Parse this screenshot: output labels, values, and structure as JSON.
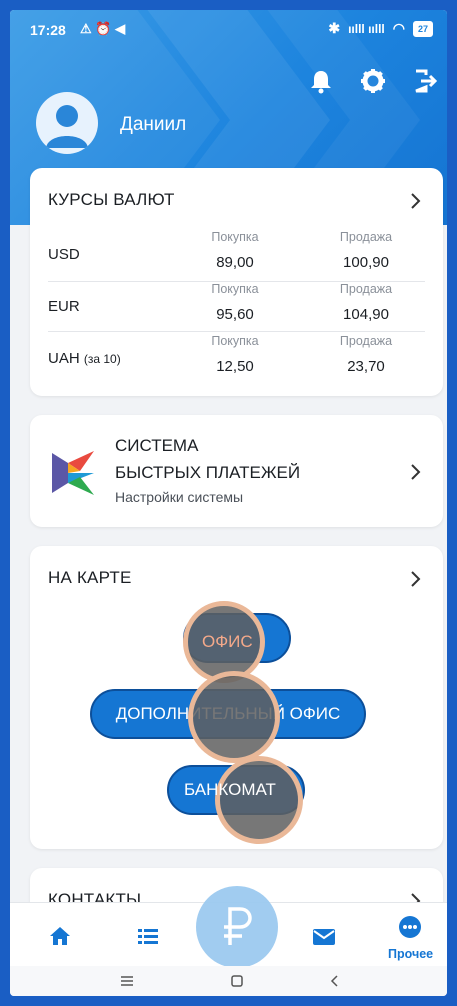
{
  "status_bar": {
    "time": "17:28",
    "battery": "27"
  },
  "header": {
    "user_name": "Даниил"
  },
  "rates": {
    "title": "КУРСЫ ВАЛЮТ",
    "rows": [
      {
        "currency": "USD",
        "suffix": "",
        "buy_label": "Покупка",
        "buy": "89,00",
        "sell_label": "Продажа",
        "sell": "100,90"
      },
      {
        "currency": "EUR",
        "suffix": "",
        "buy_label": "Покупка",
        "buy": "95,60",
        "sell_label": "Продажа",
        "sell": "104,90"
      },
      {
        "currency": "UAH",
        "suffix": "(за 10)",
        "buy_label": "Покупка",
        "buy": "12,50",
        "sell_label": "Продажа",
        "sell": "23,70"
      }
    ]
  },
  "sbp": {
    "line1": "СИСТЕМА",
    "line2": "БЫСТРЫХ ПЛАТЕЖЕЙ",
    "subtitle": "Настройки системы"
  },
  "map": {
    "title": "НА КАРТЕ",
    "office": "ОФИС",
    "extra_office": "ДОПОЛНИТЕЛЬНЫЙ ОФИС",
    "atm": "БАНКОМАТ"
  },
  "contacts": {
    "title": "КОНТАКТЫ"
  },
  "bottom_nav": {
    "more_label": "Прочее"
  },
  "colors": {
    "primary": "#1576d3",
    "header": "#1d84de",
    "touch_ring": "#eab898"
  }
}
